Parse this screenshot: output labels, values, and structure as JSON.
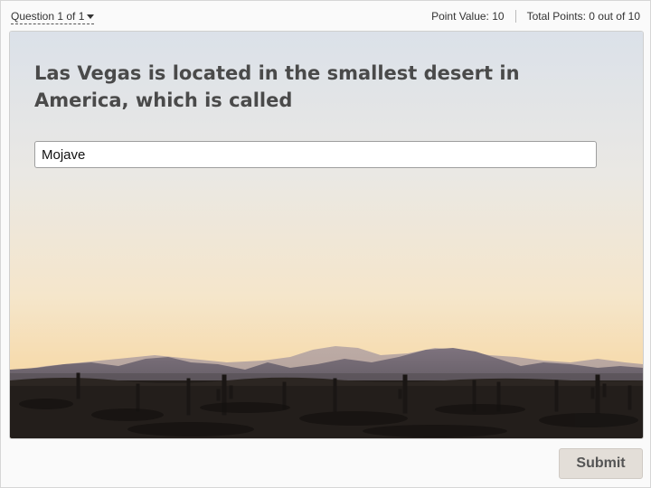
{
  "header": {
    "question_nav": "Question 1 of 1",
    "point_value": "Point Value: 10",
    "total_points": "Total Points: 0 out of 10"
  },
  "question": {
    "text": "Las Vegas is located in the smallest desert in America, which is called",
    "answer_value": "Mojave"
  },
  "footer": {
    "submit_label": "Submit"
  },
  "background": {
    "scene": "desert-sunset-image",
    "sky_top": "#dde3ea",
    "sky_bottom": "#f7ddb0",
    "mountain_color": "#8a7f8c",
    "ground_color": "#221d1a"
  }
}
